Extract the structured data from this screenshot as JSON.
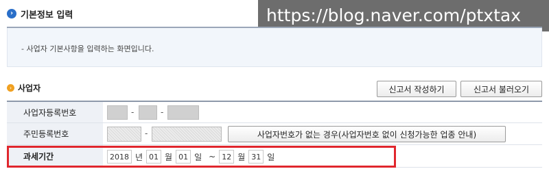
{
  "header": {
    "icon": "arrow-right-icon",
    "title": "기본정보 입력"
  },
  "watermark": {
    "text": "https://blog.naver.com/ptxtax"
  },
  "notice": {
    "text": "- 사업자 기본사항을 입력하는 화면입니다."
  },
  "section": {
    "icon": "bullet-icon",
    "title": "사업자"
  },
  "buttons": {
    "write": "신고서 작성하기",
    "load": "신고서 불러오기",
    "no_biz_number": "사업자번호가 없는 경우(사업자번호 없이 신청가능한 업종 안내)"
  },
  "form": {
    "business_number_label": "사업자등록번호",
    "resident_number_label": "주민등록번호",
    "tax_period_label": "과세기간",
    "separator": "-"
  },
  "tax_period": {
    "year": "2018",
    "year_unit": "년",
    "start_month": "01",
    "month_unit": "월",
    "start_day": "01",
    "day_unit": "일",
    "range_sep": "~",
    "end_month": "12",
    "end_day": "31"
  },
  "colors": {
    "highlight": "#e0262d",
    "header_icon": "#2a6fc9",
    "section_icon": "#f0a020"
  }
}
